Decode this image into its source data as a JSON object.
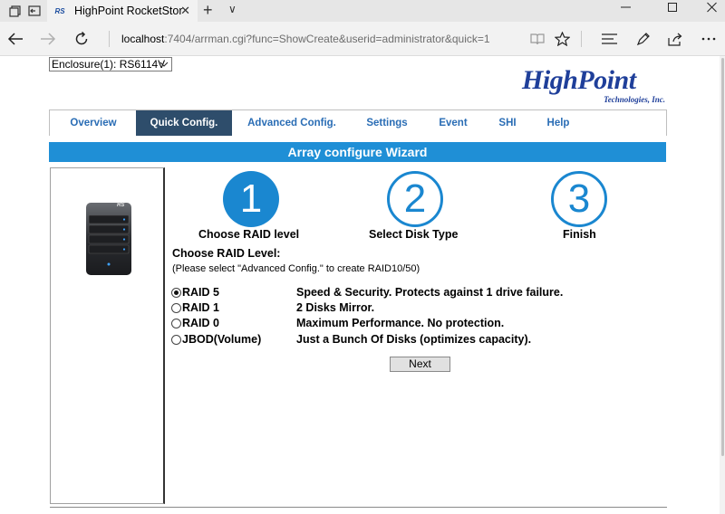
{
  "browser": {
    "tab_favicon": "RS",
    "tab_title": "HighPoint RocketStor R",
    "tab_close": "✕",
    "new_tab": "+",
    "tab_menu": "∨",
    "url_host": "localhost",
    "url_rest": ":7404/arrman.cgi?func=ShowCreate&userid=administrator&quick=1",
    "icons": [
      "tab-list-icon",
      "set-aside-tabs-icon",
      "back-arrow-icon",
      "forward-arrow-icon",
      "refresh-icon",
      "reading-view-icon",
      "favorite-star-icon",
      "hub-icon",
      "pen-icon",
      "share-icon",
      "more-icon",
      "minimize-icon",
      "maximize-icon",
      "close-icon"
    ]
  },
  "enclosure": {
    "selected": "Enclosure(1): RS6114V"
  },
  "logo": {
    "main": "HighPoint",
    "sub": "Technologies, Inc."
  },
  "nav": {
    "items": [
      {
        "label": "Overview",
        "active": false
      },
      {
        "label": "Quick Config.",
        "active": true
      },
      {
        "label": "Advanced Config.",
        "active": false
      },
      {
        "label": "Settings",
        "active": false
      },
      {
        "label": "Event",
        "active": false
      },
      {
        "label": "SHI",
        "active": false
      },
      {
        "label": "Help",
        "active": false
      }
    ]
  },
  "wizard": {
    "title": "Array configure Wizard",
    "steps": [
      {
        "number": "1",
        "label": "Choose RAID level",
        "active": true
      },
      {
        "number": "2",
        "label": "Select Disk Type",
        "active": false
      },
      {
        "number": "3",
        "label": "Finish",
        "active": false
      }
    ],
    "choose_title": "Choose RAID Level:",
    "choose_hint": "(Please select \"Advanced Config.\" to create RAID10/50)",
    "options": [
      {
        "name": "RAID 5",
        "desc": "Speed & Security. Protects against 1 drive failure.",
        "checked": true
      },
      {
        "name": "RAID 1",
        "desc": "2 Disks Mirror.",
        "checked": false
      },
      {
        "name": "RAID 0",
        "desc": "Maximum Performance. No protection.",
        "checked": false
      },
      {
        "name": "JBOD(Volume)",
        "desc": "Just a Bunch Of Disks (optimizes capacity).",
        "checked": false
      }
    ],
    "next_label": "Next"
  },
  "device": {
    "badge": "RS"
  },
  "colors": {
    "accent_blue": "#1f8fd6",
    "nav_active_bg": "#2e4d6b",
    "nav_link": "#2a6db5",
    "logo_blue": "#1f3f9a"
  }
}
